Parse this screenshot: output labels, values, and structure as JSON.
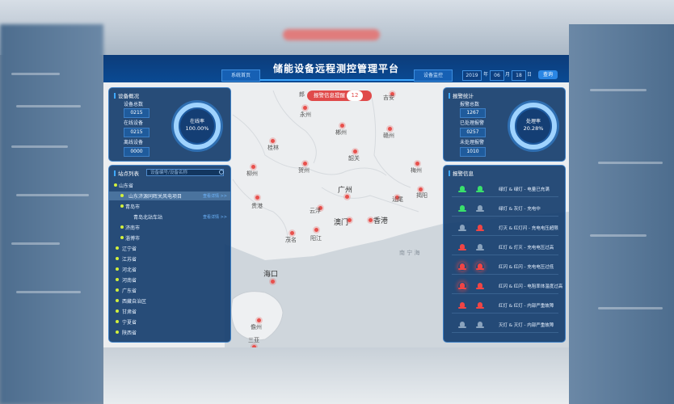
{
  "app": {
    "title": "储能设备远程测控管理平台",
    "nav_left": "系统首页",
    "nav_right": "设备监控",
    "date": {
      "year": "2019",
      "year_unit": "年",
      "month": "06",
      "month_unit": "月",
      "day": "18",
      "day_unit": "日",
      "go_label": "查询"
    }
  },
  "alert": {
    "label": "报警信息提醒",
    "count": "12"
  },
  "device_overview": {
    "title": "设备概况",
    "stats": [
      {
        "label": "设备总数",
        "value": "0215"
      },
      {
        "label": "在线设备",
        "value": "0215"
      },
      {
        "label": "离线设备",
        "value": "0000"
      }
    ],
    "ring": {
      "label": "在线率",
      "value": "100.00%",
      "fraction": 1.0
    }
  },
  "alarm_stats": {
    "title": "报警统计",
    "stats": [
      {
        "label": "报警总数",
        "value": "1267"
      },
      {
        "label": "已处理报警",
        "value": "0257"
      },
      {
        "label": "未处理报警",
        "value": "1010"
      }
    ],
    "ring": {
      "label": "处理率",
      "value": "20.28%",
      "fraction": 0.2028
    }
  },
  "site_list": {
    "title": "站点列表",
    "search_placeholder": "设备编号/设备名称",
    "items": [
      {
        "label": "山东省"
      },
      {
        "label": "山东济源同晖关风电项目",
        "link": "查看详情 >>"
      },
      {
        "label": "青岛市"
      },
      {
        "label": "青岛北站车站",
        "link": "查看详情 >>"
      },
      {
        "label": "济南市"
      },
      {
        "label": "淄博市"
      },
      {
        "label": "辽宁省"
      },
      {
        "label": "江苏省"
      },
      {
        "label": "河北省"
      },
      {
        "label": "河南省"
      },
      {
        "label": "广东省"
      },
      {
        "label": "西藏自治区"
      },
      {
        "label": "甘肃省"
      },
      {
        "label": "宁夏省"
      },
      {
        "label": "陕西省"
      }
    ]
  },
  "alarm_info": {
    "title": "报警信息",
    "rows": [
      {
        "text": "绿灯 & 绿灯 - 电量已充满",
        "left": "green",
        "right": "green"
      },
      {
        "text": "绿灯 & 灰灯 - 充电中",
        "left": "green",
        "right": "gray"
      },
      {
        "text": "灯灭 & 红灯闪 - 充电电压超限",
        "left": "gray",
        "right": "red"
      },
      {
        "text": "红灯 & 灯灭 - 充电电压过高",
        "left": "red",
        "right": "gray"
      },
      {
        "text": "红闪 & 红闪 - 充电电压过低",
        "left": "red-glow",
        "right": "red-glow"
      },
      {
        "text": "红闪 & 红闪 - 电阻率体温度过高",
        "left": "red-glow",
        "right": "red"
      },
      {
        "text": "红灯 & 红灯 - 内部严重故障",
        "left": "red",
        "right": "red"
      },
      {
        "text": "灭灯 & 灭灯 - 内部严重故障",
        "left": "gray",
        "right": "gray"
      }
    ]
  },
  "map": {
    "cities": [
      "永州",
      "郴州",
      "赣州",
      "吉安",
      "桂林",
      "韶关",
      "柳州",
      "贺州",
      "梅州",
      "广州",
      "汕尾",
      "揭阳",
      "贵港",
      "云浮",
      "澳门",
      "香港",
      "茂名",
      "阳江",
      "海口",
      "儋州",
      "三亚",
      "南 宁 海",
      "郎"
    ]
  }
}
